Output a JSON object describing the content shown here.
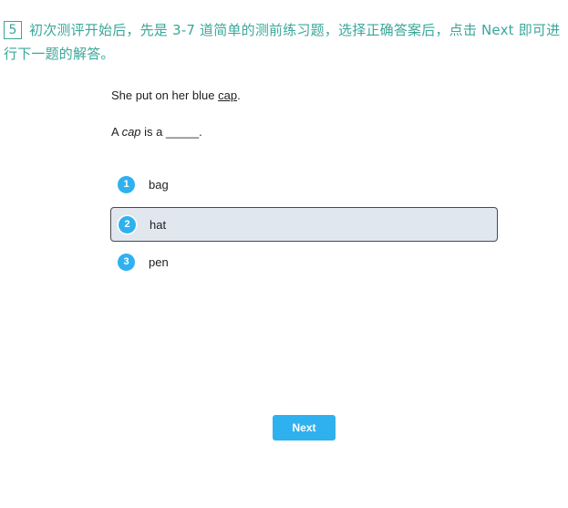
{
  "instruction": {
    "step_number": "5",
    "text": "初次测评开始后，先是 3-7 道简单的测前练习题，选择正确答案后，点击 Next 即可进行下一题的解答。"
  },
  "question": {
    "sentence_before": "She put on her blue ",
    "sentence_word": "cap",
    "sentence_after": ".",
    "prompt_before": "A ",
    "prompt_word": "cap",
    "prompt_after": " is a _____."
  },
  "options": [
    {
      "number": "1",
      "label": "bag",
      "selected": false
    },
    {
      "number": "2",
      "label": "hat",
      "selected": true
    },
    {
      "number": "3",
      "label": "pen",
      "selected": false
    }
  ],
  "next_button": {
    "label": "Next"
  },
  "colors": {
    "accent": "#2fb1f0",
    "instruction_text": "#3aa79a",
    "selected_bg": "#e1e7ef"
  }
}
